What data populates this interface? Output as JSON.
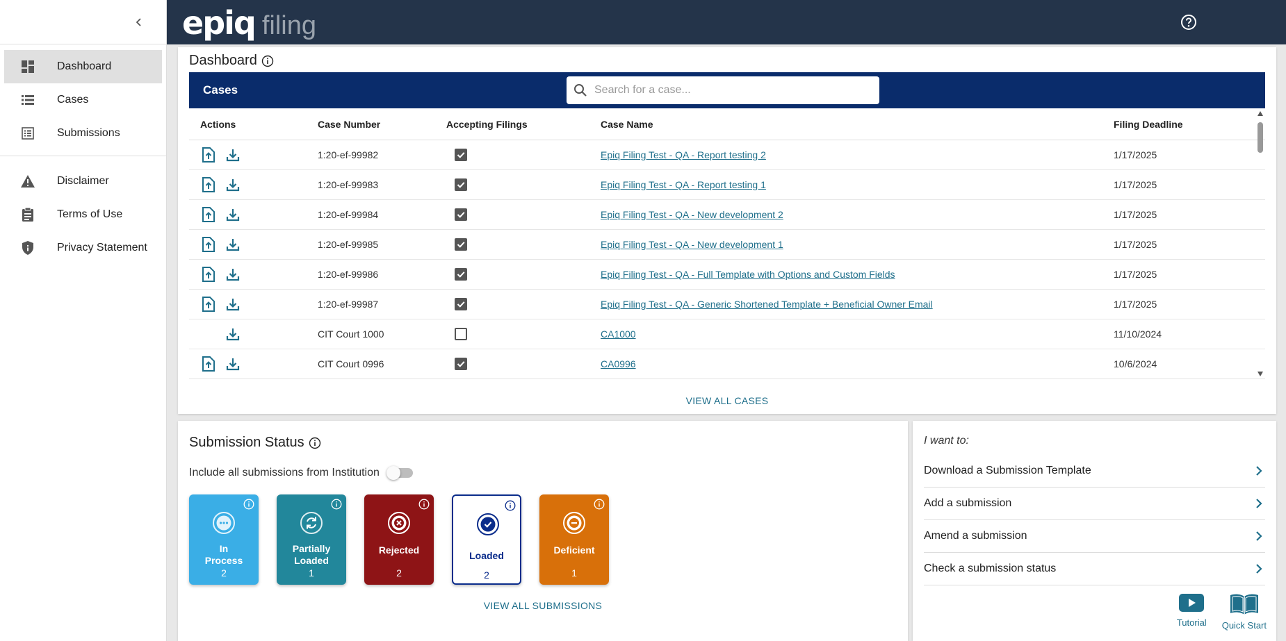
{
  "sidebar": {
    "nav": [
      {
        "label": "Dashboard",
        "icon": "dashboard-icon",
        "active": true
      },
      {
        "label": "Cases",
        "icon": "list-icon"
      },
      {
        "label": "Submissions",
        "icon": "submissions-icon"
      }
    ],
    "info": [
      {
        "label": "Disclaimer",
        "icon": "warning-icon"
      },
      {
        "label": "Terms of Use",
        "icon": "clipboard-icon"
      },
      {
        "label": "Privacy Statement",
        "icon": "shield-icon"
      }
    ]
  },
  "header": {
    "logo_main": "epiq",
    "logo_sub": "filing"
  },
  "dashboard": {
    "title": "Dashboard",
    "cases_label": "Cases",
    "search_placeholder": "Search for a case...",
    "columns": [
      "Actions",
      "Case Number",
      "Accepting Filings",
      "Case Name",
      "Filing Deadline"
    ],
    "rows": [
      {
        "upload": true,
        "number": "1:20-ef-99982",
        "accepting": true,
        "name": "Epiq Filing Test - QA - Report testing 2",
        "deadline": "1/17/2025"
      },
      {
        "upload": true,
        "number": "1:20-ef-99983",
        "accepting": true,
        "name": "Epiq Filing Test - QA - Report testing 1",
        "deadline": "1/17/2025"
      },
      {
        "upload": true,
        "number": "1:20-ef-99984",
        "accepting": true,
        "name": "Epiq Filing Test - QA - New development 2",
        "deadline": "1/17/2025"
      },
      {
        "upload": true,
        "number": "1:20-ef-99985",
        "accepting": true,
        "name": "Epiq Filing Test - QA - New development 1",
        "deadline": "1/17/2025"
      },
      {
        "upload": true,
        "number": "1:20-ef-99986",
        "accepting": true,
        "name": "Epiq Filing Test - QA - Full Template with Options and Custom Fields",
        "deadline": "1/17/2025"
      },
      {
        "upload": true,
        "number": "1:20-ef-99987",
        "accepting": true,
        "name": "Epiq Filing Test - QA - Generic Shortened Template + Beneficial Owner Email",
        "deadline": "1/17/2025"
      },
      {
        "upload": false,
        "number": "CIT Court 1000",
        "accepting": false,
        "name": "CA1000",
        "deadline": "11/10/2024"
      },
      {
        "upload": true,
        "number": "CIT Court 0996",
        "accepting": true,
        "name": "CA0996",
        "deadline": "10/6/2024"
      }
    ],
    "view_all": "VIEW ALL CASES"
  },
  "submission_status": {
    "title": "Submission Status",
    "include_label": "Include all submissions from Institution",
    "include_on": false,
    "tiles": [
      {
        "label_lines": [
          "In",
          "Process"
        ],
        "count": "2",
        "color": "#3aaee6",
        "icon": "more-icon",
        "style": "filled"
      },
      {
        "label_lines": [
          "Partially",
          "Loaded"
        ],
        "count": "1",
        "color": "#22879b",
        "icon": "refresh-icon",
        "style": "filled"
      },
      {
        "label_lines": [
          "Rejected"
        ],
        "count": "2",
        "color": "#8e1416",
        "icon": "x-circle-icon",
        "style": "filled"
      },
      {
        "label_lines": [
          "Loaded"
        ],
        "count": "2",
        "color": "#0a2c8b",
        "icon": "check-circle-icon",
        "style": "outlined"
      },
      {
        "label_lines": [
          "Deficient"
        ],
        "count": "1",
        "color": "#d8700a",
        "icon": "minus-circle-icon",
        "style": "filled"
      }
    ],
    "view_all": "VIEW ALL SUBMISSIONS"
  },
  "i_want_to": {
    "title": "I want to:",
    "items": [
      "Download a Submission Template",
      "Add a submission",
      "Amend a submission",
      "Check a submission status"
    ],
    "resources": [
      {
        "label": "Tutorial",
        "icon": "play-icon"
      },
      {
        "label": "Quick Start",
        "icon": "book-icon"
      }
    ]
  },
  "colors": {
    "header_bg": "#24344a",
    "cases_bar": "#0a2c6b",
    "link": "#1f6f8b",
    "action_icon": "#1f6f8b"
  }
}
